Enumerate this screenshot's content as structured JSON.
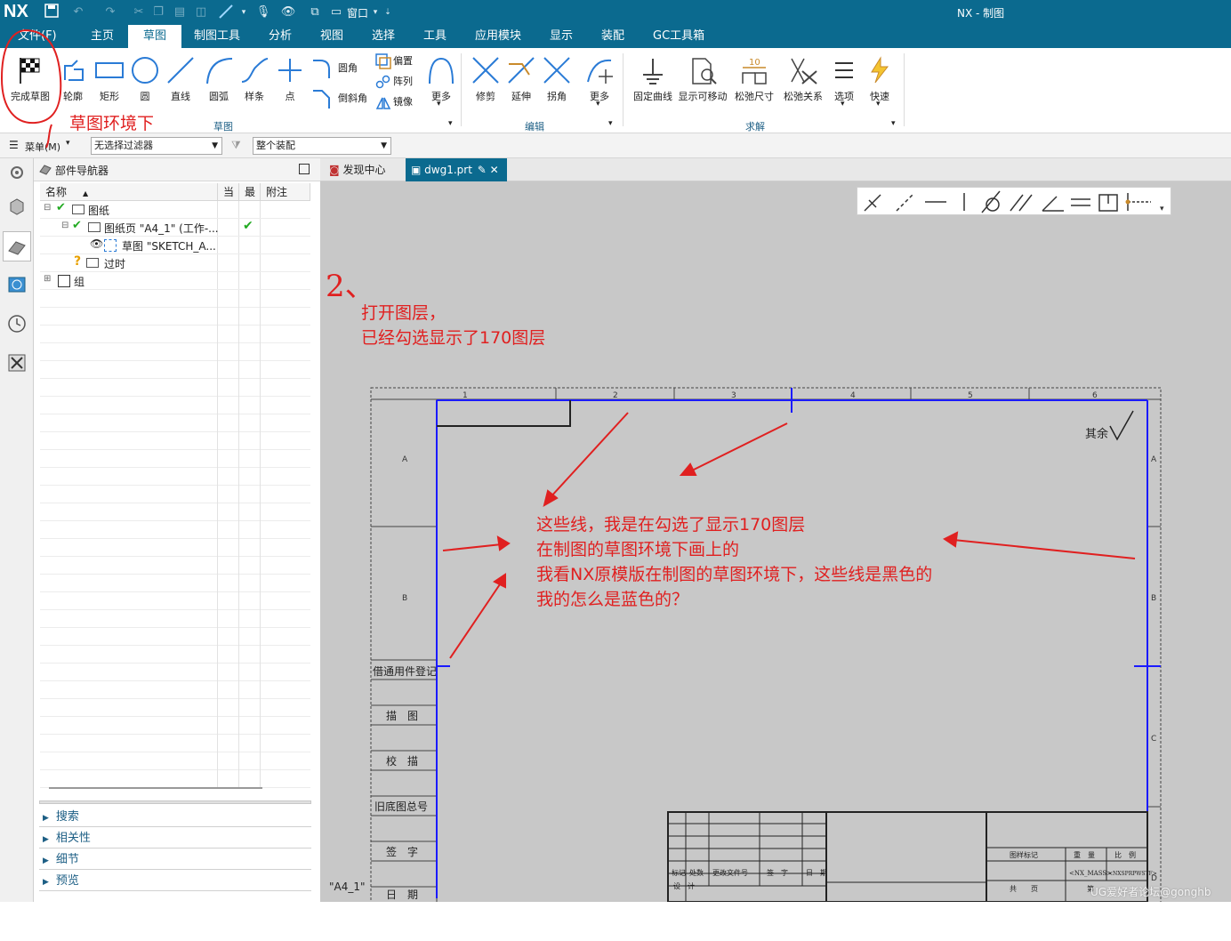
{
  "app": {
    "logo": "NX",
    "title": "NX - 制图",
    "window_menu": "窗口"
  },
  "menubar": {
    "file": "文件(F)",
    "tabs": [
      "主页",
      "草图",
      "制图工具",
      "分析",
      "视图",
      "选择",
      "工具",
      "应用模块",
      "显示",
      "装配",
      "GC工具箱"
    ],
    "active_tab": "草图"
  },
  "ribbon": {
    "sketch_group": {
      "finish": "完成草图",
      "profile": "轮廓",
      "rect": "矩形",
      "circle": "圆",
      "line": "直线",
      "arc": "圆弧",
      "spline": "样条",
      "point": "点",
      "fillet": "圆角",
      "chamfer": "倒斜角",
      "offset": "偏置",
      "pattern": "阵列",
      "mirror": "镜像",
      "more": "更多",
      "label": "草图"
    },
    "edit_group": {
      "trim": "修剪",
      "extend": "延伸",
      "corner": "拐角",
      "more": "更多",
      "label": "编辑"
    },
    "solve_group": {
      "fixed": "固定曲线",
      "show_movable": "显示可移动",
      "relax_dim": "松弛尺寸",
      "relax_rel": "松弛关系",
      "options": "选项",
      "quick": "快速",
      "label": "求解",
      "dim_value": "10"
    }
  },
  "filterbar": {
    "menu": "菜单(M)",
    "filter": "无选择过滤器",
    "scope": "整个装配"
  },
  "navigator": {
    "title": "部件导航器",
    "columns": {
      "name": "名称",
      "current": "当",
      "latest": "最",
      "note": "附注"
    },
    "rows": [
      {
        "label": "图纸"
      },
      {
        "label": "图纸页 \"A4_1\" (工作-..."
      },
      {
        "label": "草图 \"SKETCH_A..."
      },
      {
        "label": "过时"
      },
      {
        "label": "组"
      }
    ],
    "sections": [
      "搜索",
      "相关性",
      "细节",
      "预览"
    ]
  },
  "doc_tabs": [
    {
      "label": "发现中心"
    },
    {
      "label": "dwg1.prt"
    }
  ],
  "drawing": {
    "col_numbers": [
      "1",
      "2",
      "3",
      "4",
      "5",
      "6"
    ],
    "row_letters": [
      "A",
      "B",
      "C",
      "D"
    ],
    "left_boxes": [
      "借通用件登记",
      "描　图",
      "校　描",
      "旧底图总号",
      "签　字",
      "日　期"
    ],
    "roughness_text": "其余",
    "sheet_name": "\"A4_1\"",
    "title_block": {
      "mark_label": "图样标记",
      "weight": "重　量",
      "scale": "比　例",
      "weight_val": "<NX_MASS>",
      "scale_val": "<NXSPRPWSTF>",
      "rev_row": [
        "标记",
        "处数",
        "更改文件号",
        "签　字",
        "日　期"
      ],
      "design": "设　计",
      "sheets": "共　　页",
      "sheet_no": "第"
    }
  },
  "annotations": {
    "env": "草图环境下",
    "step": "2、",
    "layer_note": [
      "打开图层，",
      "已经勾选显示了170图层"
    ],
    "question": [
      "这些线，我是在勾选了显示170图层",
      "在制图的草图环境下画上的",
      "我看NX原模版在制图的草图环境下，这些线是黑色的",
      "我的怎么是蓝色的？"
    ],
    "watermark": "UG爱好者论坛@gonghb",
    "color_red": "#e02020"
  }
}
